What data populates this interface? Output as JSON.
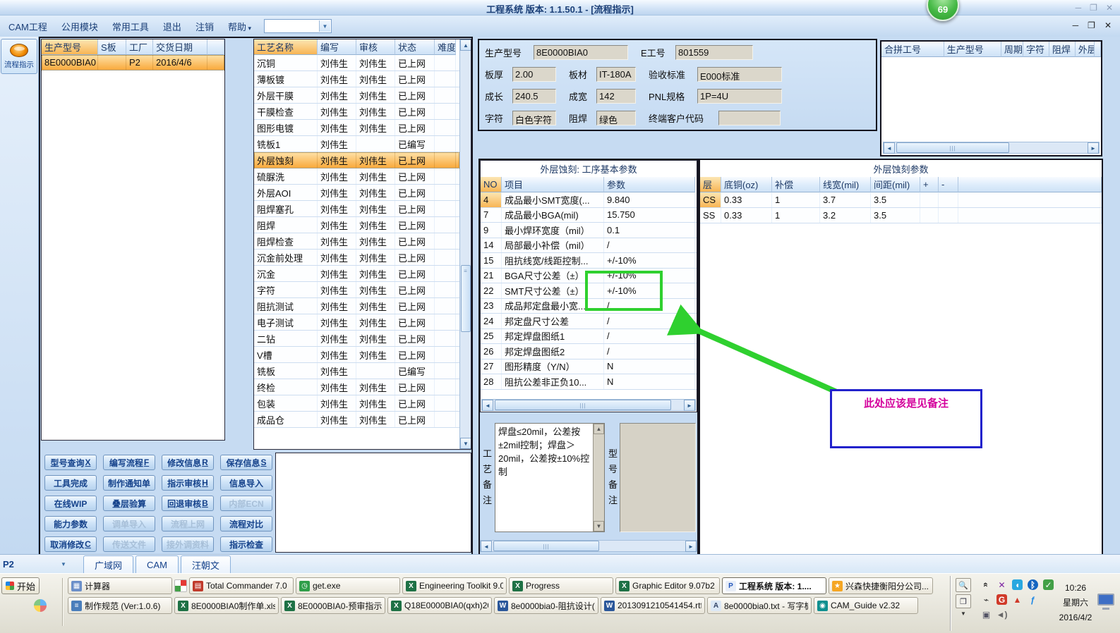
{
  "window": {
    "title": "工程系统  版本: 1.1.50.1 - [流程指示]",
    "badge": "69"
  },
  "menu_bar": {
    "items": [
      "CAM工程",
      "公用模块",
      "常用工具",
      "退出",
      "注销",
      "帮助"
    ]
  },
  "sidebar": {
    "flow_label": "流程指示"
  },
  "orders_table": {
    "headers": [
      "生产型号",
      "S板",
      "工厂",
      "交货日期"
    ],
    "rows": [
      {
        "cells": [
          "8E0000BIA0",
          "",
          "P2",
          "2016/4/6"
        ],
        "selected": true
      }
    ]
  },
  "process_table": {
    "headers": [
      "工艺名称",
      "编写",
      "审核",
      "状态",
      "难度"
    ],
    "selected_index": 6,
    "rows": [
      [
        "沉铜",
        "刘伟生",
        "刘伟生",
        "已上网",
        ""
      ],
      [
        "薄板镀",
        "刘伟生",
        "刘伟生",
        "已上网",
        ""
      ],
      [
        "外层干膜",
        "刘伟生",
        "刘伟生",
        "已上网",
        ""
      ],
      [
        "干膜检查",
        "刘伟生",
        "刘伟生",
        "已上网",
        ""
      ],
      [
        "图形电镀",
        "刘伟生",
        "刘伟生",
        "已上网",
        ""
      ],
      [
        "铣板1",
        "刘伟生",
        "",
        "已编写",
        ""
      ],
      [
        "外层蚀刻",
        "刘伟生",
        "刘伟生",
        "已上网",
        ""
      ],
      [
        "硫脲洗",
        "刘伟生",
        "刘伟生",
        "已上网",
        ""
      ],
      [
        "外层AOI",
        "刘伟生",
        "刘伟生",
        "已上网",
        ""
      ],
      [
        "阻焊塞孔",
        "刘伟生",
        "刘伟生",
        "已上网",
        ""
      ],
      [
        "阻焊",
        "刘伟生",
        "刘伟生",
        "已上网",
        ""
      ],
      [
        "阻焊检查",
        "刘伟生",
        "刘伟生",
        "已上网",
        ""
      ],
      [
        "沉金前处理",
        "刘伟生",
        "刘伟生",
        "已上网",
        ""
      ],
      [
        "沉金",
        "刘伟生",
        "刘伟生",
        "已上网",
        ""
      ],
      [
        "字符",
        "刘伟生",
        "刘伟生",
        "已上网",
        ""
      ],
      [
        "阻抗测试",
        "刘伟生",
        "刘伟生",
        "已上网",
        ""
      ],
      [
        "电子测试",
        "刘伟生",
        "刘伟生",
        "已上网",
        ""
      ],
      [
        "二钻",
        "刘伟生",
        "刘伟生",
        "已上网",
        ""
      ],
      [
        "V槽",
        "刘伟生",
        "刘伟生",
        "已上网",
        ""
      ],
      [
        "铣板",
        "刘伟生",
        "",
        "已编写",
        ""
      ],
      [
        "终检",
        "刘伟生",
        "刘伟生",
        "已上网",
        ""
      ],
      [
        "包装",
        "刘伟生",
        "刘伟生",
        "已上网",
        ""
      ],
      [
        "成品仓",
        "刘伟生",
        "刘伟生",
        "已上网",
        ""
      ]
    ]
  },
  "info_panel": {
    "rows": [
      [
        {
          "label": "生产型号",
          "value": "8E0000BIA0"
        },
        {
          "label": "E工号",
          "value": "801559"
        }
      ],
      [
        {
          "label": "板厚",
          "value": "2.00"
        },
        {
          "label": "板材",
          "value": "IT-180A"
        },
        {
          "label": "验收标准",
          "value": "E000标准"
        }
      ],
      [
        {
          "label": "成长",
          "value": "240.5"
        },
        {
          "label": "成宽",
          "value": "142"
        },
        {
          "label": "PNL规格",
          "value": "1P=4U"
        }
      ],
      [
        {
          "label": "字符",
          "value": "白色字符"
        },
        {
          "label": "阻焊",
          "value": "绿色"
        },
        {
          "label": "终端客户代码",
          "value": ""
        }
      ]
    ]
  },
  "merge_table": {
    "headers": [
      "合拼工号",
      "生产型号",
      "周期",
      "字符",
      "阻焊",
      "外层"
    ]
  },
  "step_params": {
    "title": "外层蚀刻: 工序基本参数",
    "headers": [
      "NO",
      "项目",
      "参数"
    ],
    "rows": [
      [
        "4",
        "成品最小SMT宽度(...",
        "9.840"
      ],
      [
        "7",
        "成品最小BGA(mil)",
        "15.750"
      ],
      [
        "9",
        "最小焊环宽度（mil）",
        "0.1"
      ],
      [
        "14",
        "局部最小补偿（mil）",
        "/"
      ],
      [
        "15",
        "阻抗线宽/线距控制...",
        "+/-10%"
      ],
      [
        "21",
        "BGA尺寸公差（±）",
        "+/-10%"
      ],
      [
        "22",
        "SMT尺寸公差（±）",
        "+/-10%"
      ],
      [
        "23",
        "成品邦定盘最小宽...",
        "/"
      ],
      [
        "24",
        "邦定盘尺寸公差",
        "/"
      ],
      [
        "25",
        "邦定焊盘图纸1",
        "/"
      ],
      [
        "26",
        "邦定焊盘图纸2",
        "/"
      ],
      [
        "27",
        "图形精度（Y/N）",
        "N"
      ],
      [
        "28",
        "阻抗公差非正负10...",
        "N"
      ]
    ]
  },
  "remarks": {
    "process_label": "工艺备注",
    "process_text": "焊盘≤20mil，公差按±2mil控制；焊盘＞20mil，公差按±10%控制",
    "model_label": "型号备注",
    "model_text": ""
  },
  "etch_params": {
    "title": "外层蚀刻参数",
    "headers": [
      "层",
      "底铜(oz)",
      "补偿",
      "线宽(mil)",
      "间距(mil)",
      "+",
      "-"
    ],
    "rows": [
      [
        "CS",
        "0.33",
        "1",
        "3.7",
        "3.5",
        "",
        ""
      ],
      [
        "SS",
        "0.33",
        "1",
        "3.2",
        "3.5",
        "",
        ""
      ]
    ]
  },
  "annotation": {
    "text": "此处应该是见备注",
    "border_color": "#2222cc",
    "text_color": "#d4009c",
    "arrow_color": "#2fd02f"
  },
  "action_buttons": [
    [
      {
        "label": "型号查询",
        "hotkey": "X"
      },
      {
        "label": "编写流程",
        "hotkey": "F"
      },
      {
        "label": "修改信息",
        "hotkey": "R"
      },
      {
        "label": "保存信息",
        "hotkey": "S"
      }
    ],
    [
      {
        "label": "工具完成"
      },
      {
        "label": "制作通知单"
      },
      {
        "label": "指示审核",
        "hotkey": "H"
      },
      {
        "label": "信息导入"
      }
    ],
    [
      {
        "label": "在线WIP"
      },
      {
        "label": "叠层验算"
      },
      {
        "label": "回退审核",
        "hotkey": "B"
      },
      {
        "label": "内部ECN",
        "disabled": true
      }
    ],
    [
      {
        "label": "能力参数"
      },
      {
        "label": "调单导入",
        "disabled": true
      },
      {
        "label": "流程上网",
        "disabled": true
      },
      {
        "label": "流程对比"
      }
    ],
    [
      {
        "label": "取消修改",
        "hotkey": "C"
      },
      {
        "label": "传送文件",
        "disabled": true
      },
      {
        "label": "接外调资料",
        "disabled": true
      },
      {
        "label": "指示检查"
      }
    ]
  ],
  "status_strip": {
    "factory": "P2",
    "tabs": [
      "广域网",
      "CAM",
      "汪朝文"
    ]
  },
  "taskbar": {
    "start": "开始",
    "row1": [
      {
        "label": "计算器",
        "icon": "calculator"
      },
      {
        "label": "Total Commander 7.0 ...",
        "icon": "disk"
      },
      {
        "label": "get.exe",
        "icon": "clock"
      },
      {
        "label": "Engineering Toolkit 9.0...",
        "icon": "excel"
      },
      {
        "label": "Progress",
        "icon": "excel"
      },
      {
        "label": "Graphic Editor 9.07b2 (...",
        "icon": "excel"
      },
      {
        "label": "工程系统  版本: 1....",
        "icon": "app",
        "active": true
      },
      {
        "label": "兴森快捷衡阳分公司...",
        "icon": "star"
      }
    ],
    "row2": [
      {
        "label": "制作规范 (Ver:1.0.6)",
        "icon": "doc"
      },
      {
        "label": "8E0000BIA0制作单.xls ...",
        "icon": "excel"
      },
      {
        "label": "8E0000BIA0-预审指示...",
        "icon": "excel"
      },
      {
        "label": "Q18E0000BIA0(qxh)20...",
        "icon": "excel"
      },
      {
        "label": "8e0000bia0-阻抗设计(...",
        "icon": "word"
      },
      {
        "label": "2013091210541454.rtf ...",
        "icon": "word"
      },
      {
        "label": "8e0000bia0.txt - 写字板",
        "icon": "wordpad"
      },
      {
        "label": "CAM_Guide v2.32",
        "icon": "cam"
      }
    ],
    "tray": {
      "time": "10:26",
      "weekday": "星期六",
      "date": "2016/4/2",
      "icon_rows": [
        [
          "collapse-icon",
          "x-app-icon",
          "messenger-icon",
          "bluetooth-icon",
          "shield-icon"
        ],
        [
          "plug-icon",
          "g-app-icon",
          "triangle-app-icon",
          "flash-app-icon"
        ],
        [
          "network-icon",
          "volume-icon"
        ]
      ]
    }
  }
}
